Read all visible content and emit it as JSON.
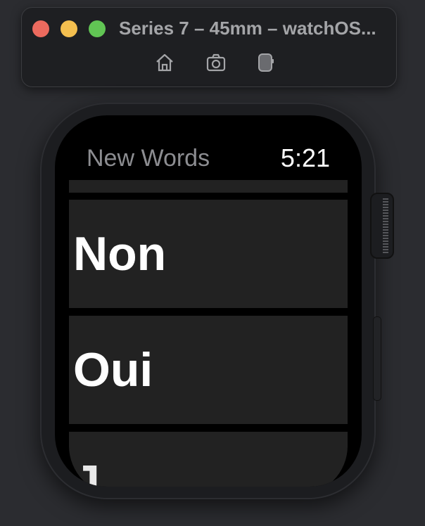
{
  "window": {
    "title": "Series 7 – 45mm – watchOS...",
    "toolbar": {
      "home_icon": "home-icon",
      "screenshot_icon": "camera-icon",
      "rotate_icon": "rotate-device-icon"
    }
  },
  "watch": {
    "nav_title": "New Words",
    "time": "5:21",
    "list": {
      "items": [
        {
          "label": "Non"
        },
        {
          "label": "Oui"
        },
        {
          "label": "J"
        }
      ]
    }
  },
  "colors": {
    "close": "#ec6a5e",
    "minimize": "#f4bf4f",
    "zoom": "#61c554",
    "row_background": "#222222",
    "screen_background": "#000000"
  }
}
